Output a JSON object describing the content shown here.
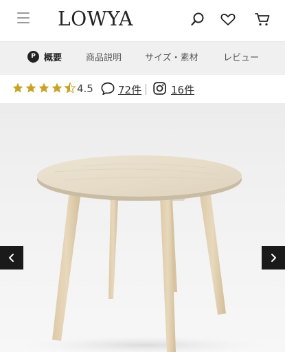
{
  "header": {
    "logo": "LOWYA",
    "icons": [
      "menu-icon",
      "search-icon",
      "heart-icon",
      "cart-icon"
    ]
  },
  "tabs": [
    {
      "label": "概要",
      "active": true,
      "icon": "info-pin-icon"
    },
    {
      "label": "商品説明",
      "active": false
    },
    {
      "label": "サイズ・素材",
      "active": false
    },
    {
      "label": "レビュー",
      "active": false
    }
  ],
  "rating": {
    "value": "4.5",
    "stars": 4.5,
    "review_count": "72件",
    "instagram_count": "16件"
  },
  "colors": {
    "star": "#c9a227",
    "nav_button": "#1a1a1a",
    "tab_bar": "#f0f0f0"
  }
}
